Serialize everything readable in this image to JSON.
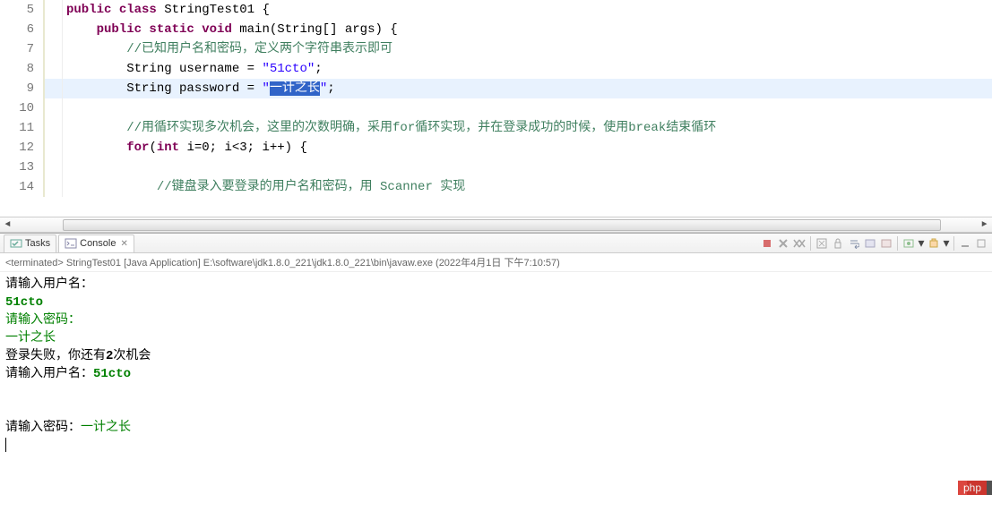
{
  "editor": {
    "lines": [
      {
        "num": "5",
        "hl": false,
        "tokens": [
          {
            "t": "public ",
            "c": "kw"
          },
          {
            "t": "class ",
            "c": "kw"
          },
          {
            "t": "StringTest01 {",
            "c": ""
          }
        ]
      },
      {
        "num": "6",
        "hl": false,
        "tokens": [
          {
            "t": "    ",
            "c": ""
          },
          {
            "t": "public ",
            "c": "kw"
          },
          {
            "t": "static ",
            "c": "kw"
          },
          {
            "t": "void ",
            "c": "kw"
          },
          {
            "t": "main(String[] args) {",
            "c": ""
          }
        ]
      },
      {
        "num": "7",
        "hl": false,
        "tokens": [
          {
            "t": "        ",
            "c": ""
          },
          {
            "t": "//已知用户名和密码，定义两个字符串表示即可",
            "c": "cmt"
          }
        ]
      },
      {
        "num": "8",
        "hl": false,
        "tokens": [
          {
            "t": "        String username = ",
            "c": ""
          },
          {
            "t": "\"51cto\"",
            "c": "str"
          },
          {
            "t": ";",
            "c": ""
          }
        ]
      },
      {
        "num": "9",
        "hl": true,
        "tokens": [
          {
            "t": "        String password = ",
            "c": ""
          },
          {
            "t": "\"",
            "c": "str"
          },
          {
            "t": "一计之长",
            "c": "sel"
          },
          {
            "t": "\"",
            "c": "str"
          },
          {
            "t": ";",
            "c": ""
          }
        ]
      },
      {
        "num": "10",
        "hl": false,
        "tokens": []
      },
      {
        "num": "11",
        "hl": false,
        "tokens": [
          {
            "t": "        ",
            "c": ""
          },
          {
            "t": "//用循环实现多次机会，这里的次数明确，采用for循环实现，并在登录成功的时候，使用break结束循环",
            "c": "cmt"
          }
        ]
      },
      {
        "num": "12",
        "hl": false,
        "tokens": [
          {
            "t": "        ",
            "c": ""
          },
          {
            "t": "for",
            "c": "kw"
          },
          {
            "t": "(",
            "c": ""
          },
          {
            "t": "int ",
            "c": "kw"
          },
          {
            "t": "i=0; i<3; i++) {",
            "c": ""
          }
        ]
      },
      {
        "num": "13",
        "hl": false,
        "tokens": []
      },
      {
        "num": "14",
        "hl": false,
        "tokens": [
          {
            "t": "            ",
            "c": ""
          },
          {
            "t": "//键盘录入要登录的用户名和密码，用 Scanner 实现",
            "c": "cmt"
          }
        ]
      }
    ]
  },
  "tabs": {
    "tasks": "Tasks",
    "console": "Console"
  },
  "launch_info": "<terminated> StringTest01 [Java Application] E:\\software\\jdk1.8.0_221\\jdk1.8.0_221\\bin\\javaw.exe (2022年4月1日 下午7:10:57)",
  "console": {
    "line1": "请输入用户名：",
    "line2": "51cto",
    "line3": "请输入密码：",
    "line4": "一计之长",
    "line5_a": "登录失败，你还有",
    "line5_b": "2",
    "line5_c": "次机会",
    "line6_a": "请输入用户名：",
    "line6_b": "51cto",
    "line7_a": "请输入密码：",
    "line7_b": "一计之长"
  },
  "watermark": "php"
}
